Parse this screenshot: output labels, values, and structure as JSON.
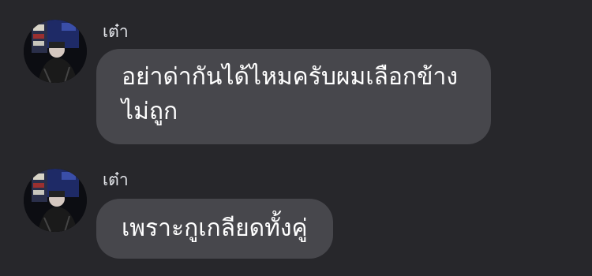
{
  "messages": [
    {
      "sender": "เต๋า",
      "text": "อย่าด่ากันได้ไหมครับผมเลือกข้าง\nไม่ถูก"
    },
    {
      "sender": "เต๋า",
      "text": "เพราะกูเกลียดทั้งคู่"
    }
  ],
  "colors": {
    "background": "#27272b",
    "bubble": "#47474c",
    "text": "#ffffff"
  }
}
